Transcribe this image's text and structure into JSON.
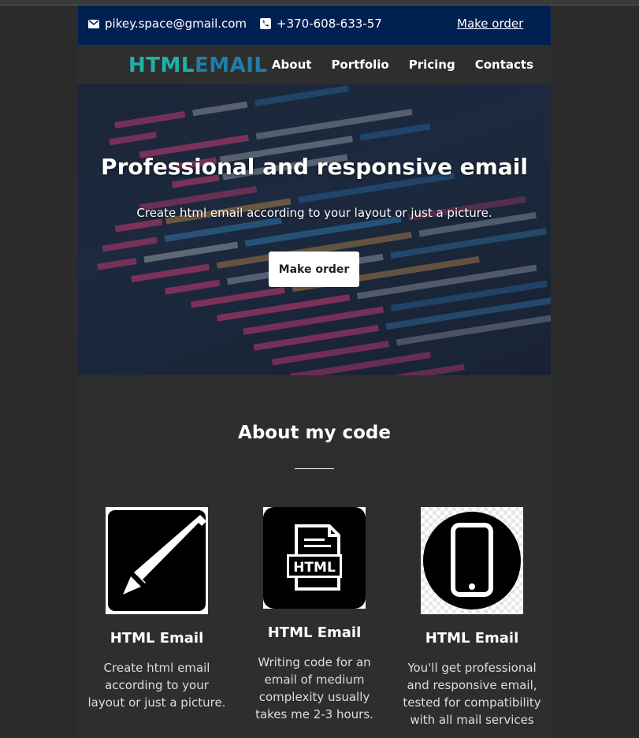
{
  "topbar": {
    "email": "pikey.space@gmail.com",
    "phone": "+370-608-633-57",
    "order_link": "Make order",
    "background": "#002052"
  },
  "navbar": {
    "logo_part1": "HTML",
    "logo_part2": "EMAIL",
    "items": [
      "About",
      "Portfolio",
      "Pricing",
      "Contacts"
    ]
  },
  "hero": {
    "title": "Professional and responsive email",
    "subtitle": "Create html email according to your layout or just a picture.",
    "button_label": "Make order"
  },
  "about": {
    "title": "About my code",
    "cards": [
      {
        "icon": "pencil-icon",
        "title": "HTML Email",
        "text": "Create html email according to your layout or just a picture."
      },
      {
        "icon": "html-file-icon",
        "title": "HTML Email",
        "text": "Writing code for an email of medium complexity usually takes me 2-3 hours."
      },
      {
        "icon": "smartphone-icon",
        "title": "HTML Email",
        "text": "You'll get professional and responsive email, tested for compatibility with all mail services"
      }
    ]
  }
}
